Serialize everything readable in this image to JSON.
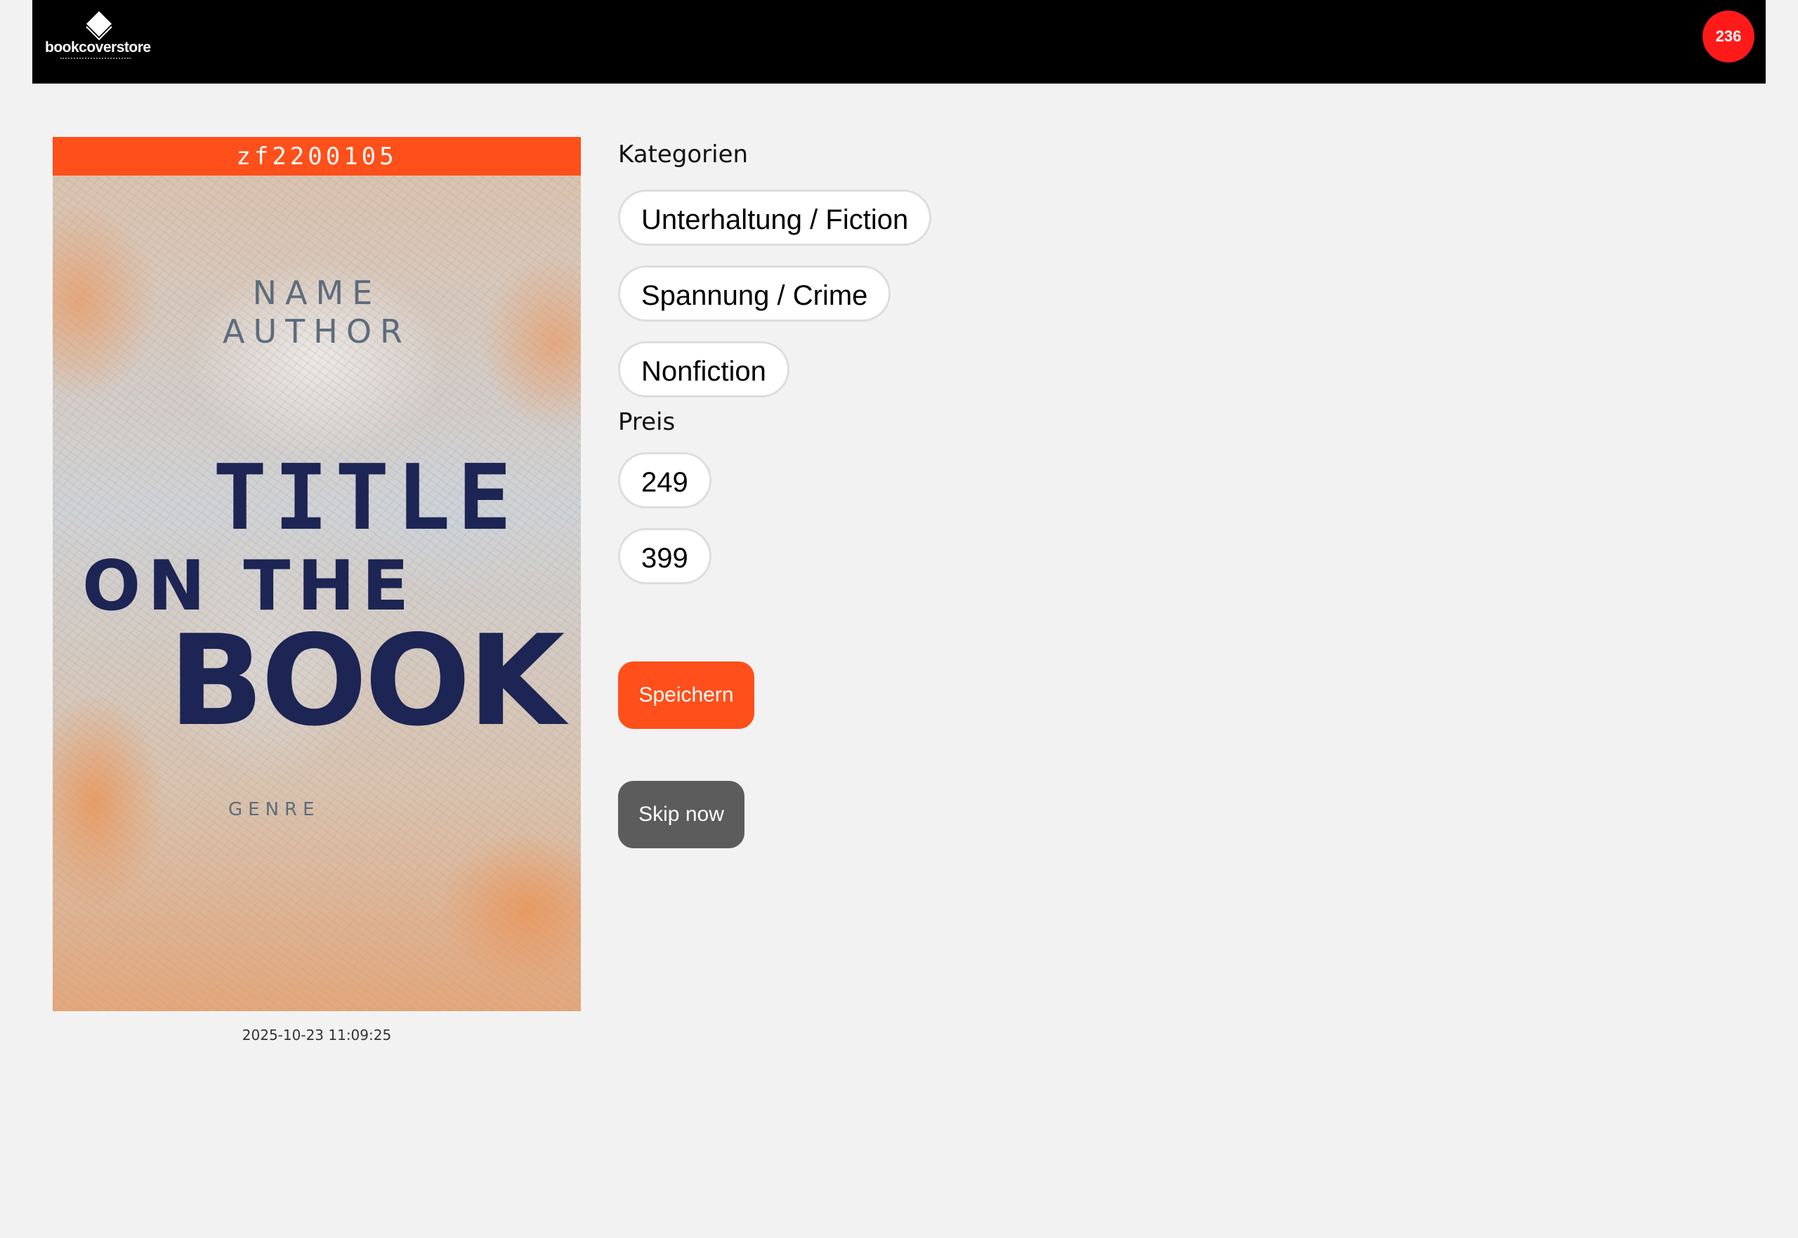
{
  "header": {
    "logo_text": "bookcoverstore",
    "badge_count": "236"
  },
  "cover": {
    "id": "zf2200105",
    "name": "NAME",
    "author": "AUTHOR",
    "title_line1": "TITLE",
    "title_line2": "ON THE",
    "title_line3": "BOOK",
    "genre": "GENRE",
    "timestamp": "2025-10-23 11:09:25"
  },
  "form": {
    "categories_label": "Kategorien",
    "categories": [
      "Unterhaltung / Fiction",
      "Spannung / Crime",
      "Nonfiction"
    ],
    "price_label": "Preis",
    "prices": [
      "249",
      "399"
    ],
    "save_label": "Speichern",
    "skip_label": "Skip now"
  },
  "colors": {
    "accent": "#ff4f1a",
    "badge": "#ff1a1a",
    "skip_button": "#5c5c5c",
    "header_bg": "#000000",
    "page_bg": "#f2f2f2"
  }
}
